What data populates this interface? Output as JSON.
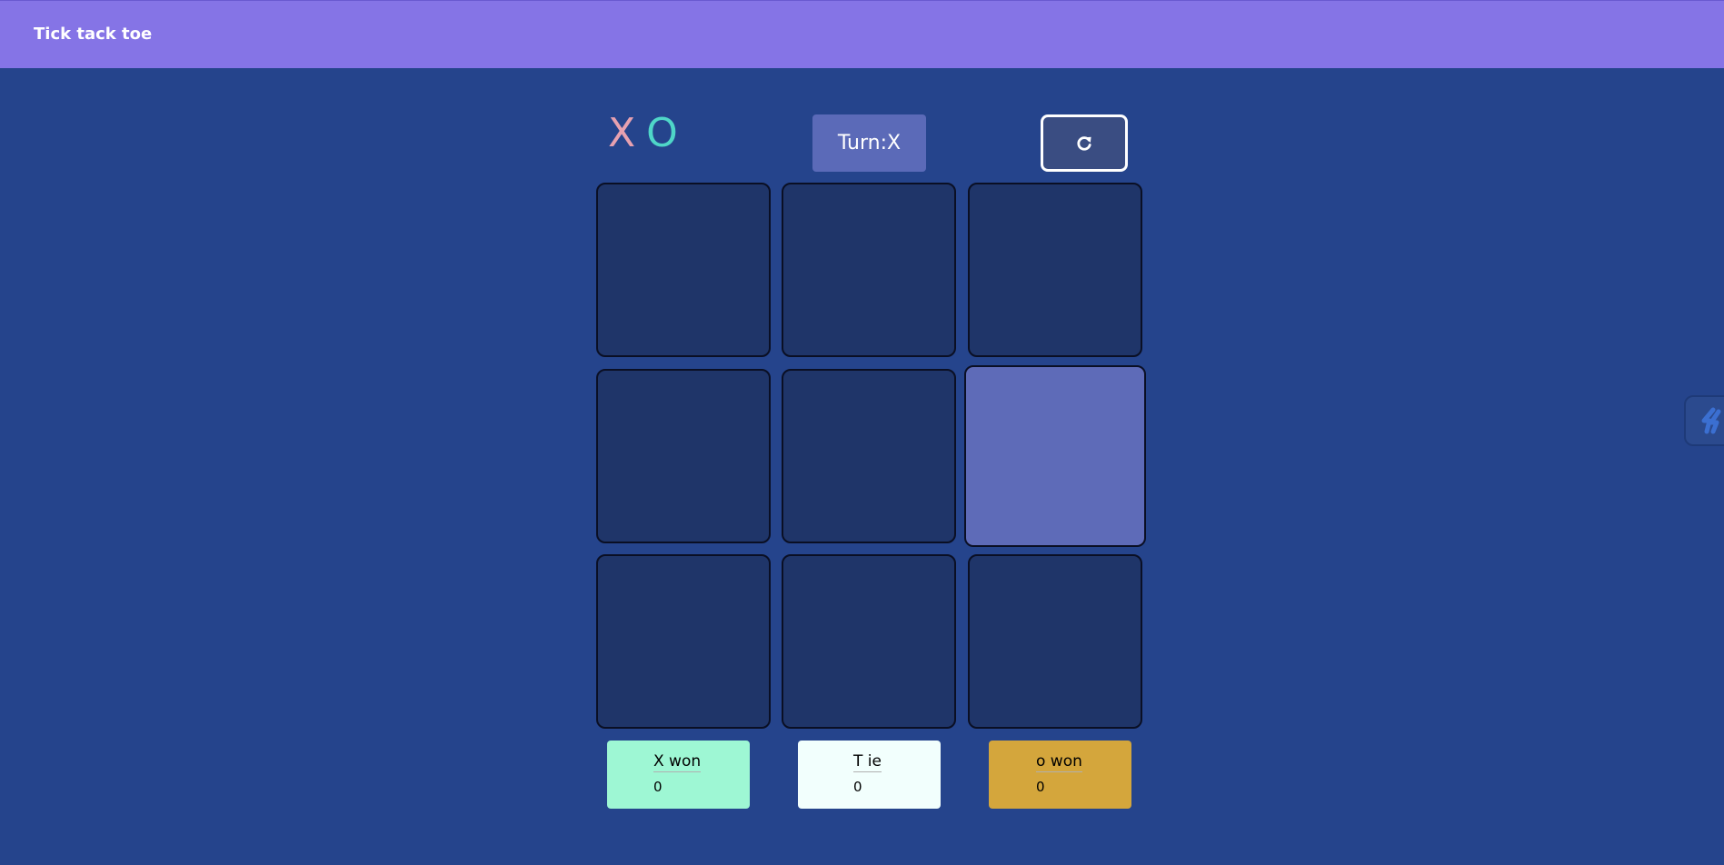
{
  "navbar": {
    "title": "Tick tack toe"
  },
  "logo": {
    "x": "X",
    "o": "O"
  },
  "turn": {
    "label": "Turn:X"
  },
  "reset": {
    "icon": "refresh-icon"
  },
  "board": {
    "cells": [
      "",
      "",
      "",
      "",
      "",
      "",
      "",
      "",
      ""
    ],
    "highlighted_cell": 5
  },
  "scores": {
    "x": {
      "label": "X won",
      "value": "0"
    },
    "tie": {
      "label": "T ie",
      "value": "0"
    },
    "o": {
      "label": "o won",
      "value": "0"
    }
  },
  "colors": {
    "background": "#25448c",
    "navbar": "#8574e6",
    "cell": "#1f3569",
    "cell_hover": "#5e6bb8",
    "x_color": "#e7a1b0",
    "o_color": "#4fd6c8",
    "x_score_bg": "#9ef7d4",
    "tie_score_bg": "#f2fffd",
    "o_score_bg": "#d4a63c"
  }
}
